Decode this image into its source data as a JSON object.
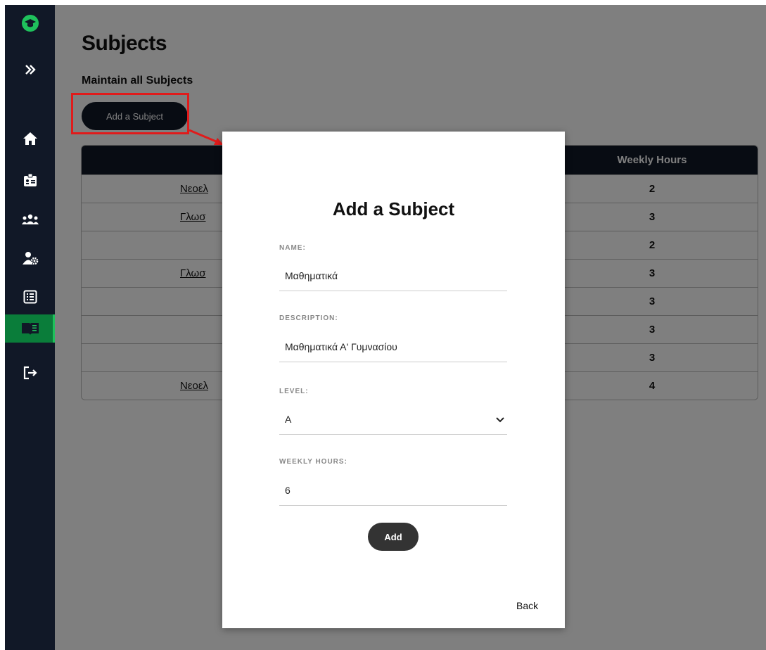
{
  "sidebar": {
    "icons": [
      "logo-icon",
      "expand-icon",
      "home-icon",
      "id-badge-icon",
      "users-icon",
      "user-gear-icon",
      "list-icon",
      "book-icon",
      "logout-icon"
    ]
  },
  "page": {
    "title": "Subjects",
    "subtitle": "Maintain all Subjects",
    "add_button": "Add a Subject"
  },
  "table": {
    "hours_header": "Weekly Hours",
    "rows": [
      {
        "name": "Νεοελ",
        "hours": "2"
      },
      {
        "name": "Γλωσ",
        "hours": "3"
      },
      {
        "name": "",
        "hours": "2"
      },
      {
        "name": "Γλωσ",
        "hours": "3"
      },
      {
        "name": "",
        "hours": "3"
      },
      {
        "name": "",
        "hours": "3"
      },
      {
        "name": "",
        "hours": "3"
      },
      {
        "name": "Νεοελ",
        "hours": "4"
      }
    ]
  },
  "modal": {
    "title": "Add a Subject",
    "name_label": "NAME:",
    "name_value": "Μαθηματικά",
    "description_label": "DESCRIPTION:",
    "description_value": "Μαθηματικά Α' Γυμνασίου",
    "level_label": "LEVEL:",
    "level_value": "A",
    "hours_label": "WEEKLY HOURS:",
    "hours_value": "6",
    "add_button": "Add",
    "back": "Back"
  },
  "colors": {
    "sidebar": "#111827",
    "accent": "#1fc15c",
    "highlight": "#e01b1b"
  }
}
